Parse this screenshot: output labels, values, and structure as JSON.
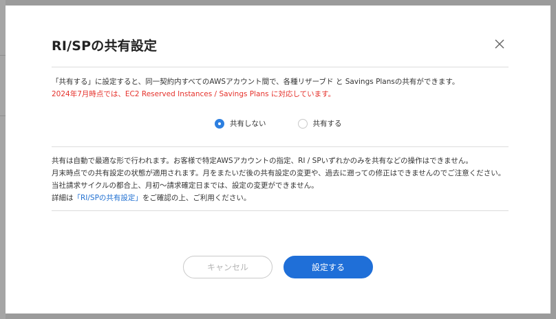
{
  "modal": {
    "title": "RI/SPの共有設定",
    "close_icon": "close-icon",
    "intro_line1": "「共有する」に設定すると、同一契約内すべてのAWSアカウント間で、各種リザーブド と Savings Plansの共有ができます。",
    "intro_line2": "2024年7月時点では、EC2 Reserved Instances / Savings Plans に対応しています。",
    "radio_options": [
      {
        "label": "共有しない",
        "checked": true
      },
      {
        "label": "共有する",
        "checked": false
      }
    ],
    "notes": [
      "共有は自動で最適な形で行われます。お客様で特定AWSアカウントの指定、RI / SPいずれかのみを共有などの操作はできません。",
      "月末時点での共有設定の状態が適用されます。月をまたいだ後の共有設定の変更や、過去に遡っての修正はできませんのでご注意ください。",
      "当社請求サイクルの都合上、月初～請求確定日までは、設定の変更ができません。"
    ],
    "detail_prefix": "詳細は",
    "detail_link": "「RI/SPの共有設定」",
    "detail_suffix": "をご確認の上、ご利用ください。",
    "cancel_label": "キャンセル",
    "submit_label": "設定する",
    "colors": {
      "accent": "#1f6fd8",
      "warning": "#e5312b",
      "link": "#1f6fd1"
    }
  }
}
